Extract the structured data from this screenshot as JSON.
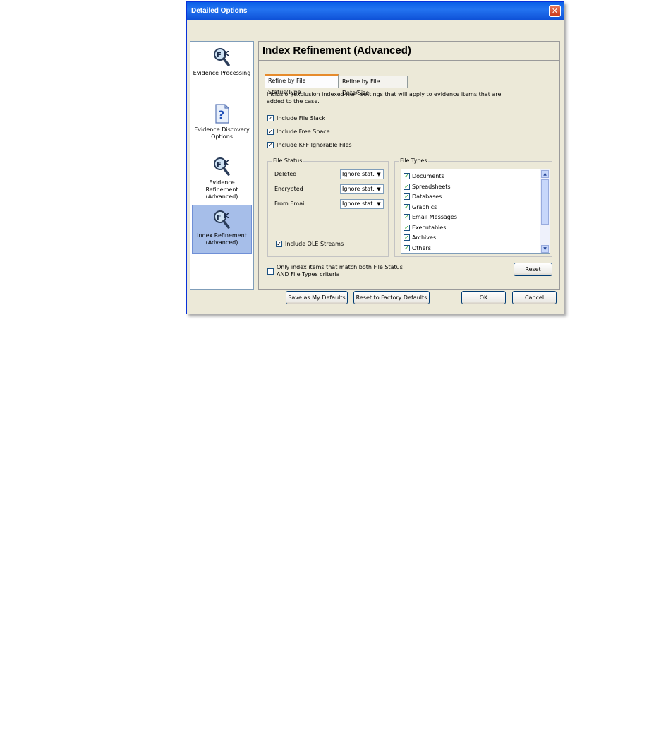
{
  "window": {
    "title": "Detailed Options",
    "close_glyph": "✕"
  },
  "nav": {
    "items": [
      {
        "label": "Evidence Processing",
        "icon": "ftk-magnifier-icon",
        "selected": false
      },
      {
        "label": "Evidence Discovery Options",
        "icon": "help-document-icon",
        "selected": false
      },
      {
        "label": "Evidence Refinement (Advanced)",
        "icon": "ftk-magnifier-icon",
        "selected": false
      },
      {
        "label": "Index Refinement (Advanced)",
        "icon": "ftk-magnifier-icon",
        "selected": true
      }
    ]
  },
  "content": {
    "heading": "Index Refinement (Advanced)",
    "tabs": [
      {
        "label": "Refine by File Status/Type",
        "active": true
      },
      {
        "label": "Refine by File Date/Size",
        "active": false
      }
    ],
    "description": "Inclusion/exclusion indexed item settings that will apply to evidence items that are added to the case.",
    "description_line1": "Inclusion/exclusion indexed item settings that will apply to evidence items that are",
    "description_line2": "added to the case.",
    "checkboxes": [
      {
        "label": "Include File Slack",
        "checked": true
      },
      {
        "label": "Include Free Space",
        "checked": true
      },
      {
        "label": "Include KFF Ignorable Files",
        "checked": true
      }
    ],
    "file_status": {
      "label": "File Status",
      "rows": [
        {
          "label": "Deleted",
          "value": "Ignore stat."
        },
        {
          "label": "Encrypted",
          "value": "Ignore stat."
        },
        {
          "label": "From Email",
          "value": "Ignore stat."
        }
      ],
      "include_ole": {
        "label": "Include OLE Streams",
        "checked": true
      }
    },
    "file_types": {
      "label": "File Types",
      "items": [
        {
          "label": "Documents",
          "checked": true
        },
        {
          "label": "Spreadsheets",
          "checked": true
        },
        {
          "label": "Databases",
          "checked": true
        },
        {
          "label": "Graphics",
          "checked": true
        },
        {
          "label": "Email Messages",
          "checked": true
        },
        {
          "label": "Executables",
          "checked": true
        },
        {
          "label": "Archives",
          "checked": true
        },
        {
          "label": "Others",
          "checked": true
        }
      ]
    },
    "match_both": {
      "line1": "Only index items that match both File Status",
      "line2": "AND File Types criteria",
      "checked": false
    },
    "reset_label": "Reset"
  },
  "footer": {
    "save_defaults": "Save as My Defaults",
    "reset_factory": "Reset to Factory Defaults",
    "ok": "OK",
    "cancel": "Cancel"
  },
  "glyphs": {
    "check": "✓",
    "dropdown_arrow": "▼",
    "scroll_up": "▲",
    "scroll_down": "▼"
  }
}
